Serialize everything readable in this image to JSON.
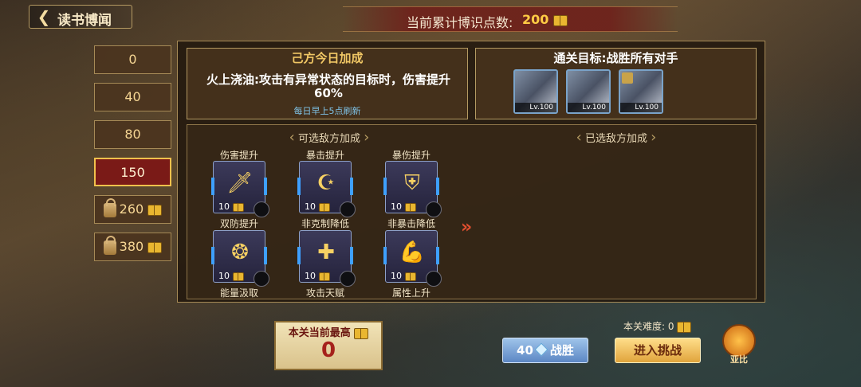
{
  "header": {
    "title": "读书博闻",
    "points_label": "当前累计博识点数:",
    "points_value": "200"
  },
  "tabs": [
    {
      "label": "0",
      "locked": false
    },
    {
      "label": "40",
      "locked": false
    },
    {
      "label": "80",
      "locked": false
    },
    {
      "label": "150",
      "locked": false,
      "active": true
    },
    {
      "label": "260",
      "locked": true
    },
    {
      "label": "380",
      "locked": true
    }
  ],
  "bonus": {
    "title": "己方今日加成",
    "description": "火上浇油:攻击有异常状态的目标时，伤害提升60%",
    "refresh_note": "每日早上5点刷新"
  },
  "goal": {
    "title": "通关目标:战胜所有对手",
    "enemies": [
      {
        "level": "Lv.100"
      },
      {
        "level": "Lv.100"
      },
      {
        "level": "Lv.100"
      }
    ]
  },
  "selectable_header": "可选敌方加成",
  "selected_header": "已选敌方加成",
  "skills": [
    {
      "label": "伤害提升",
      "cost": "10",
      "icon": "sword-icon",
      "glyph": "🗡"
    },
    {
      "label": "暴击提升",
      "cost": "10",
      "icon": "moon-star-icon",
      "glyph": "☪"
    },
    {
      "label": "暴伤提升",
      "cost": "10",
      "icon": "shield-icon",
      "glyph": "⛨"
    },
    {
      "label": "双防提升",
      "cost": "10",
      "icon": "emblem-icon",
      "glyph": "❂"
    },
    {
      "label": "非克制降低",
      "cost": "10",
      "icon": "cross-icon",
      "glyph": "✚"
    },
    {
      "label": "非暴击降低",
      "cost": "10",
      "icon": "flex-arm-icon",
      "glyph": "💪"
    }
  ],
  "row_bottom_labels": [
    "能量汲取",
    "攻击天赋",
    "属性上升"
  ],
  "bottom": {
    "best_label": "本关当前最高",
    "best_value": "0",
    "difficulty_label": "本关难度: 0",
    "battle_cost": "40",
    "battle_label": "战胜",
    "challenge_label": "进入挑战",
    "mascot_label": "亚比"
  },
  "colors": {
    "accent_gold": "#f1c765",
    "active_tab": "#7a1a17",
    "battle_blue": "#5c87c4",
    "challenge_gold": "#e0a43c"
  }
}
